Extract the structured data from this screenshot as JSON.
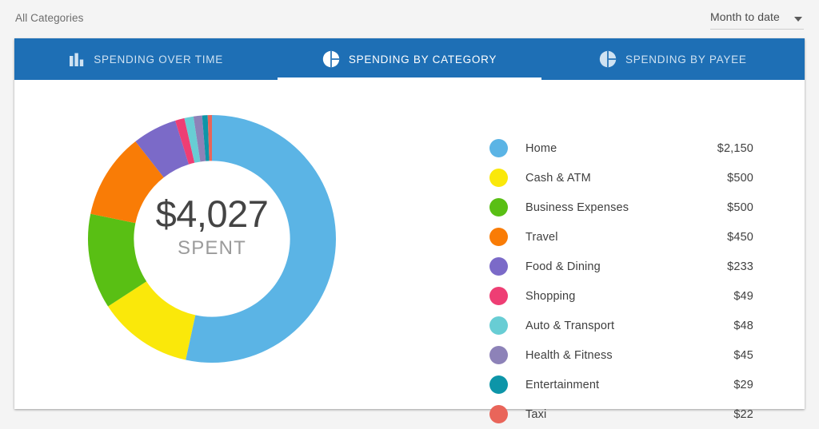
{
  "filterbar": {
    "category_filter_label": "All Categories",
    "range_value": "Month to date",
    "caret_icon": "chevron-down-icon"
  },
  "tabs": [
    {
      "label": "SPENDING OVER TIME",
      "icon": "bar-chart-icon",
      "active": false
    },
    {
      "label": "SPENDING BY CATEGORY",
      "icon": "pie-chart-icon",
      "active": true
    },
    {
      "label": "SPENDING BY PAYEE",
      "icon": "pie-chart-icon",
      "active": false
    }
  ],
  "donut": {
    "center_amount": "$4,027",
    "center_label": "SPENT"
  },
  "colors": {
    "tabbar_blue": "#1e6fb5",
    "page_background": "#f4f4f4",
    "card_background": "#ffffff"
  },
  "chart_data": {
    "type": "pie",
    "title": "Spending by Category",
    "subtitle": "Month to date",
    "total": 4027,
    "total_label": "$4,027",
    "center_text": "SPENT",
    "currency": "USD",
    "donut": true,
    "inner_radius_ratio": 0.63,
    "start_angle_deg": 0,
    "direction": "clockwise",
    "legend_position": "right",
    "categories": [
      "Home",
      "Cash & ATM",
      "Business Expenses",
      "Travel",
      "Food & Dining",
      "Shopping",
      "Auto & Transport",
      "Health & Fitness",
      "Entertainment",
      "Taxi"
    ],
    "values": [
      2150,
      500,
      500,
      450,
      233,
      49,
      48,
      45,
      29,
      22
    ],
    "value_labels": [
      "$2,150",
      "$500",
      "$500",
      "$450",
      "$233",
      "$49",
      "$48",
      "$45",
      "$29",
      "$22"
    ],
    "colors": [
      "#5bb4e5",
      "#fae80a",
      "#59bf14",
      "#f97c06",
      "#7b6ac8",
      "#ee3e74",
      "#68cdd4",
      "#8d82b8",
      "#0d95a8",
      "#e9655a"
    ],
    "slices": [
      {
        "name": "Home",
        "value": 2150,
        "label": "$2,150",
        "color": "#5bb4e5"
      },
      {
        "name": "Cash & ATM",
        "value": 500,
        "label": "$500",
        "color": "#fae80a"
      },
      {
        "name": "Business Expenses",
        "value": 500,
        "label": "$500",
        "color": "#59bf14"
      },
      {
        "name": "Travel",
        "value": 450,
        "label": "$450",
        "color": "#f97c06"
      },
      {
        "name": "Food & Dining",
        "value": 233,
        "label": "$233",
        "color": "#7b6ac8"
      },
      {
        "name": "Shopping",
        "value": 49,
        "label": "$49",
        "color": "#ee3e74"
      },
      {
        "name": "Auto & Transport",
        "value": 48,
        "label": "$48",
        "color": "#68cdd4"
      },
      {
        "name": "Health & Fitness",
        "value": 45,
        "label": "$45",
        "color": "#8d82b8"
      },
      {
        "name": "Entertainment",
        "value": 29,
        "label": "$29",
        "color": "#0d95a8"
      },
      {
        "name": "Taxi",
        "value": 22,
        "label": "$22",
        "color": "#e9655a"
      }
    ]
  }
}
